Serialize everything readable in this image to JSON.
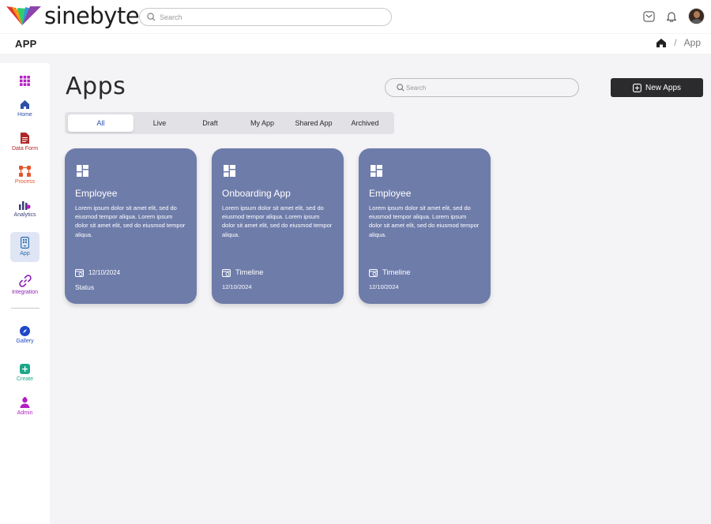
{
  "brand": {
    "name": "sinebyte"
  },
  "top_search": {
    "placeholder": "Search"
  },
  "subbar": {
    "title": "APP",
    "breadcrumb_current": "App",
    "breadcrumb_separator": "/"
  },
  "sidebar": {
    "items": [
      {
        "label": "",
        "icon": "apps-grid-icon",
        "color": "#b41ec4"
      },
      {
        "label": "Home",
        "icon": "home-icon",
        "color": "#2c4fa8"
      },
      {
        "label": "Data Form",
        "icon": "document-icon",
        "color": "#b02828"
      },
      {
        "label": "Process",
        "icon": "process-icon",
        "color": "#e2572c"
      },
      {
        "label": "Analytics",
        "icon": "analytics-icon",
        "color": "#3a3f7a"
      },
      {
        "label": "App",
        "icon": "app-icon",
        "color": "#2c6fb0"
      },
      {
        "label": "Integration",
        "icon": "integration-icon",
        "color": "#8e1fb5"
      },
      {
        "label": "Gallery",
        "icon": "compass-icon",
        "color": "#2047c9"
      },
      {
        "label": "Create",
        "icon": "plus-square-icon",
        "color": "#1ca88a"
      },
      {
        "label": "Admin",
        "icon": "admin-icon",
        "color": "#b41ec4"
      }
    ],
    "active": "App"
  },
  "main": {
    "title": "Apps",
    "search_placeholder": "Search",
    "new_button_label": "New Apps",
    "tabs": [
      "All",
      "Live",
      "Draft",
      "My App",
      "Shared App",
      "Archived"
    ],
    "active_tab": "All"
  },
  "cards": [
    {
      "title": "Employee",
      "description": "Lorem ipsum dolor sit amet elit, sed do eiusmod tempor aliqua. Lorem ipsum dolor sit amet elit, sed do eiusmod tempor aliqua.",
      "line1": "12/10/2024",
      "line2": "Status"
    },
    {
      "title": "Onboarding App",
      "description": "Lorem ipsum dolor sit amet elit, sed do eiusmod tempor aliqua. Lorem ipsum dolor sit amet elit, sed do eiusmod tempor aliqua.",
      "line1": "Timeline",
      "line2": "12/10/2024"
    },
    {
      "title": "Employee",
      "description": "Lorem ipsum dolor sit amet elit, sed do eiusmod tempor aliqua. Lorem ipsum dolor sit amet elit, sed do eiusmod tempor aliqua.",
      "line1": "Timeline",
      "line2": "12/10/2024"
    }
  ]
}
